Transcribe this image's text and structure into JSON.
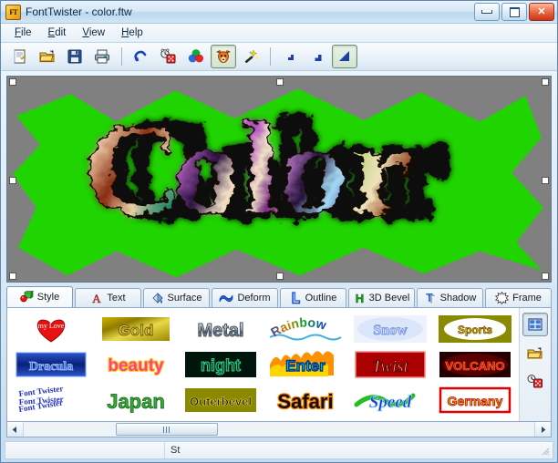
{
  "window": {
    "title": "FontTwister - color.ftw",
    "app_icon": "font-twister-icon",
    "buttons": {
      "minimize": "minimize-button",
      "maximize": "maximize-button",
      "close": "close-button",
      "close_glyph": "✕"
    }
  },
  "menu": {
    "items": [
      {
        "label": "File",
        "accel": "F"
      },
      {
        "label": "Edit",
        "accel": "E"
      },
      {
        "label": "View",
        "accel": "V"
      },
      {
        "label": "Help",
        "accel": "H"
      }
    ]
  },
  "toolbar": {
    "buttons": [
      {
        "name": "new-document-icon",
        "title": "New"
      },
      {
        "name": "open-folder-icon",
        "title": "Open"
      },
      {
        "name": "save-disk-icon",
        "title": "Save"
      },
      {
        "name": "print-icon",
        "title": "Print"
      },
      {
        "name": "undo-icon",
        "title": "Undo"
      },
      {
        "name": "random-dice-clock-icon",
        "title": "Random"
      },
      {
        "name": "color-circles-icon",
        "title": "Colors"
      },
      {
        "name": "fox-head-icon",
        "title": "Animal",
        "pressed": true
      },
      {
        "name": "magic-wand-icon",
        "title": "Effects"
      },
      {
        "name": "size-small-icon",
        "title": "Small size"
      },
      {
        "name": "size-medium-icon",
        "title": "Medium size"
      },
      {
        "name": "size-large-icon",
        "title": "Large size",
        "pressed": true
      }
    ]
  },
  "canvas": {
    "text": "Color",
    "background_color": "#808080",
    "shape_color": "#1fd400",
    "shape": "starburst-banner",
    "selection_handles": 8
  },
  "tabs": [
    {
      "label": "Style",
      "icon": "cubes-icon",
      "active": true
    },
    {
      "label": "Text",
      "icon": "letter-a-icon",
      "active": false
    },
    {
      "label": "Surface",
      "icon": "paint-bucket-icon",
      "active": false
    },
    {
      "label": "Deform",
      "icon": "wave-icon",
      "active": false
    },
    {
      "label": "Outline",
      "icon": "outline-icon",
      "active": false
    },
    {
      "label": "3D Bevel",
      "icon": "letter-h-icon",
      "active": false
    },
    {
      "label": "Shadow",
      "icon": "letter-t-shadow-icon",
      "active": false
    },
    {
      "label": "Frame",
      "icon": "starburst-icon",
      "active": false
    }
  ],
  "gallery": {
    "items": [
      {
        "label": "my Love",
        "style": "love",
        "bg": "#ffffff",
        "fg": "#ffffff"
      },
      {
        "label": "Gold",
        "style": "gold",
        "bg": "#b9a400",
        "fg": "#6a5d00"
      },
      {
        "label": "Metal",
        "style": "metal",
        "bg": "#ffffff",
        "fg": "#8c99a6"
      },
      {
        "label": "Rainbow",
        "style": "rainbow",
        "bg": "#ffffff",
        "fg": "#1050c0"
      },
      {
        "label": "Snow",
        "style": "snow",
        "bg": "#e8eefa",
        "fg": "#9fb6e6"
      },
      {
        "label": "Sports",
        "style": "sports",
        "bg": "#8a8a00",
        "fg": "#ffd400"
      },
      {
        "label": "Dracula",
        "style": "dracula",
        "bg": "#0a2a8a",
        "fg": "#7fb0ff"
      },
      {
        "label": "beauty",
        "style": "beauty",
        "bg": "#ffffff",
        "fg": "#ff2a9a"
      },
      {
        "label": "night",
        "style": "night",
        "bg": "#00140a",
        "fg": "#29d27a"
      },
      {
        "label": "Enter",
        "style": "enter",
        "bg": "#ff9000",
        "fg": "#00c8e0"
      },
      {
        "label": "Twist",
        "style": "twist",
        "bg": "#b00000",
        "fg": "#ffe08a"
      },
      {
        "label": "VOLCANO",
        "style": "volcano",
        "bg": "#2a0000",
        "fg": "#e01000"
      },
      {
        "label": "Font Twister",
        "style": "fonttwister",
        "bg": "#ffffff",
        "fg": "#2030c0"
      },
      {
        "label": "Japan",
        "style": "japan",
        "bg": "#ffffff",
        "fg": "#2aa02a"
      },
      {
        "label": "Outerbevel",
        "style": "outerbevel",
        "bg": "#8a8a00",
        "fg": "#111111"
      },
      {
        "label": "Safari",
        "style": "safari",
        "bg": "#ffffff",
        "fg": "#101010"
      },
      {
        "label": "Speed",
        "style": "speed",
        "bg": "#ffffff",
        "fg": "#2030d0"
      },
      {
        "label": "Germany",
        "style": "germany",
        "bg": "#ffffff",
        "fg": "#d8a000"
      }
    ],
    "side_buttons": [
      {
        "name": "grid-view-icon",
        "pressed": true
      },
      {
        "name": "open-folder-icon",
        "pressed": false
      },
      {
        "name": "random-dice-icon",
        "pressed": false
      }
    ]
  },
  "scrollbar": {
    "left_arrow": "◄",
    "right_arrow": "►",
    "orientation": "horizontal"
  },
  "statusbar": {
    "pane1": "",
    "pane2": "St"
  }
}
